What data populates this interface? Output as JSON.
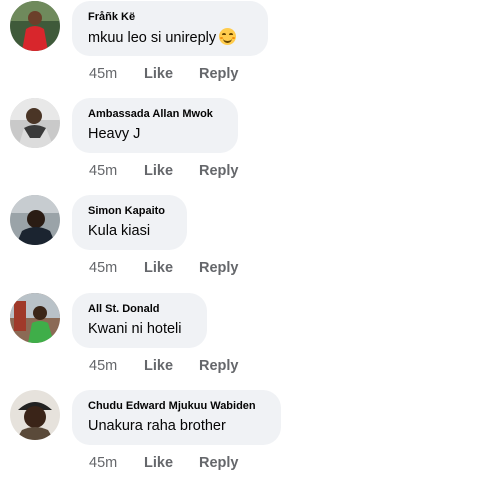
{
  "comments": [
    {
      "name": "Fråñk Kë",
      "text": "mkuu leo si unireply",
      "emoji": "smiling-face-emoji",
      "time": "45m",
      "like": "Like",
      "reply": "Reply"
    },
    {
      "name": "Ambassada Allan Mwok",
      "text": "Heavy J",
      "time": "45m",
      "like": "Like",
      "reply": "Reply"
    },
    {
      "name": "Simon Kapaito",
      "text": "Kula kiasi",
      "time": "45m",
      "like": "Like",
      "reply": "Reply"
    },
    {
      "name": "All St. Donald",
      "text": "Kwani ni hoteli",
      "time": "45m",
      "like": "Like",
      "reply": "Reply"
    },
    {
      "name": "Chudu Edward Mjukuu Wabiden",
      "text": "Unakura raha brother",
      "time": "45m",
      "like": "Like",
      "reply": "Reply"
    }
  ],
  "colors": {
    "bubble": "#f0f2f5",
    "meta": "#65676b",
    "text": "#050505"
  }
}
